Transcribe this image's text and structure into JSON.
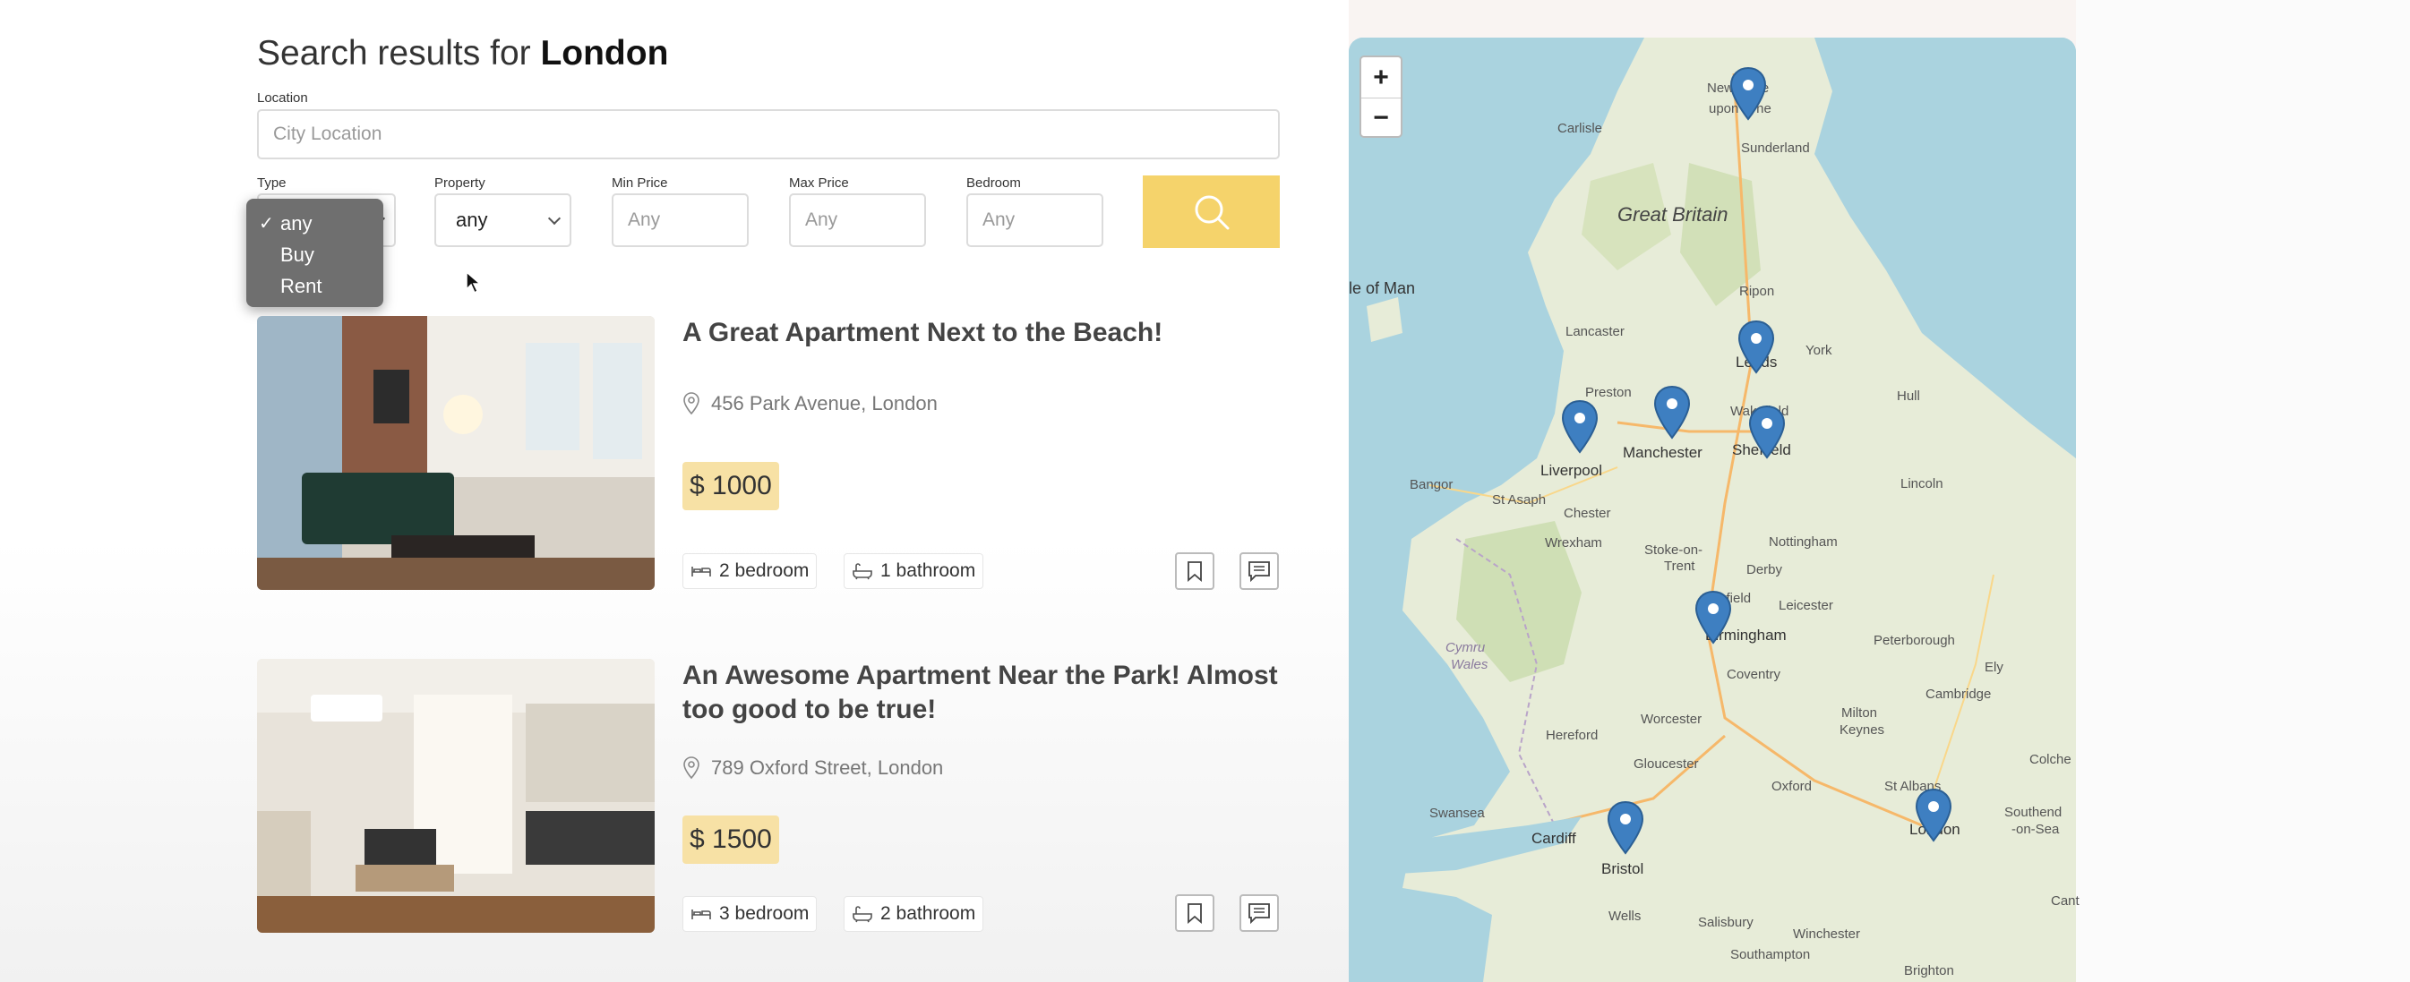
{
  "search": {
    "title_prefix": "Search results for",
    "title_city": "London",
    "location_label": "Location",
    "location_placeholder": "City Location",
    "type_label": "Type",
    "property_label": "Property",
    "property_value": "any",
    "min_price_label": "Min Price",
    "min_price_placeholder": "Any",
    "max_price_label": "Max Price",
    "max_price_placeholder": "Any",
    "bedroom_label": "Bedroom",
    "bedroom_placeholder": "Any",
    "search_icon": "magnifier-icon"
  },
  "type_dropdown": {
    "selected": "any",
    "options": [
      "any",
      "Buy",
      "Rent"
    ]
  },
  "listings": [
    {
      "title": "A Great Apartment Next to the Beach!",
      "address": "456 Park Avenue, London",
      "price": "$ 1000",
      "bedrooms": "2 bedroom",
      "bathrooms": "1 bathroom"
    },
    {
      "title": "An Awesome Apartment Near the Park! Almost too good to be true!",
      "address": "789 Oxford Street, London",
      "price": "$ 1500",
      "bedrooms": "3 bedroom",
      "bathrooms": "2 bathroom"
    }
  ],
  "map": {
    "zoom_in": "+",
    "zoom_out": "−",
    "places": {
      "newcastle_1": "Newcastle",
      "newcastle_2": "upon Tyne",
      "sunderland": "Sunderland",
      "carlisle": "Carlisle",
      "great_britain": "Great Britain",
      "isle_of_man": "le of Man",
      "ripon": "Ripon",
      "lancaster": "Lancaster",
      "leeds": "Leeds",
      "york": "York",
      "preston": "Preston",
      "wakefield": "Wakefield",
      "hull": "Hull",
      "manchester": "Manchester",
      "sheffield": "Sheffield",
      "liverpool": "Liverpool",
      "bangor": "Bangor",
      "st_asaph": "St Asaph",
      "chester": "Chester",
      "lincoln": "Lincoln",
      "wrexham": "Wrexham",
      "stoke_1": "Stoke-on-",
      "stoke_2": "Trent",
      "nottingham": "Nottingham",
      "derby": "Derby",
      "lichfield": "Lichfield",
      "leicester": "Leicester",
      "birmingham": "Birmingham",
      "peterborough": "Peterborough",
      "cymru": "Cymru",
      "wales": "Wales",
      "coventry": "Coventry",
      "ely": "Ely",
      "cambridge": "Cambridge",
      "worcester": "Worcester",
      "milton_1": "Milton",
      "milton_2": "Keynes",
      "hereford": "Hereford",
      "gloucester": "Gloucester",
      "oxford": "Oxford",
      "colchester": "Colche",
      "st_albans": "St Albans",
      "swansea": "Swansea",
      "southend_1": "Southend",
      "southend_2": "-on-Sea",
      "cardiff": "Cardiff",
      "london": "London",
      "bristol": "Bristol",
      "cant": "Cant",
      "wells": "Wells",
      "salisbury": "Salisbury",
      "winchester": "Winchester",
      "southampton": "Southampton",
      "brighton": "Brighton"
    },
    "marker_color": "#3e7fc1"
  },
  "colors": {
    "accent": "#f5d36b",
    "price_bg": "#f7e1a5"
  }
}
